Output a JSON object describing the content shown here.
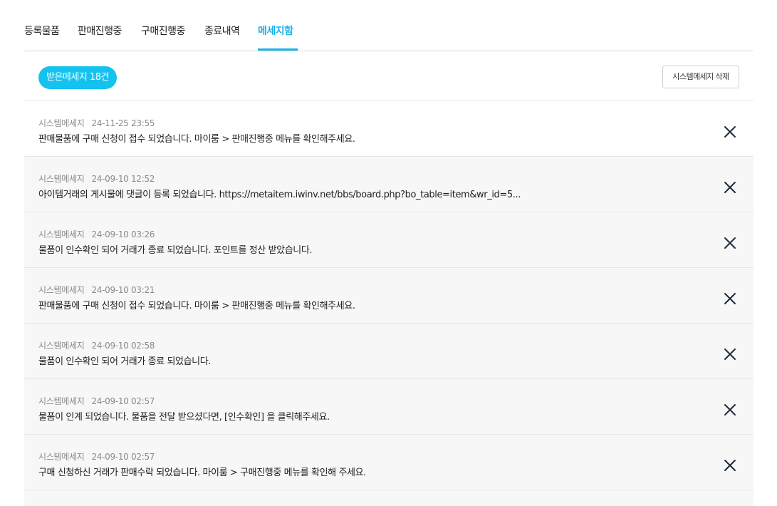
{
  "tabs": [
    {
      "label": "등록물품"
    },
    {
      "label": "판매진행중"
    },
    {
      "label": "구매진행중"
    },
    {
      "label": "종료내역"
    },
    {
      "label": "메세지함"
    }
  ],
  "active_tab": "메세지함",
  "toolbar": {
    "count_label": "받은메세지 18건",
    "delete_label": "시스템메세지 삭제"
  },
  "messages": [
    {
      "sender": "시스템메세지",
      "time": "24-11-25 23:55",
      "text": "판매물품에 구매 신청이 접수 되었습니다. 마이룸 > 판매진행중 메뉴를 확인해주세요."
    },
    {
      "sender": "시스템메세지",
      "time": "24-09-10 12:52",
      "text": "아이템거래의 게시물에 댓글이 등록 되었습니다. https://metaitem.iwinv.net/bbs/board.php?bo_table=item&wr_id=5..."
    },
    {
      "sender": "시스템메세지",
      "time": "24-09-10 03:26",
      "text": "물품이 인수확인 되어 거래가 종료 되었습니다. 포인트를 정산 받았습니다."
    },
    {
      "sender": "시스템메세지",
      "time": "24-09-10 03:21",
      "text": "판매물품에 구매 신청이 접수 되었습니다. 마이룸 > 판매진행중 메뉴를 확인해주세요."
    },
    {
      "sender": "시스템메세지",
      "time": "24-09-10 02:58",
      "text": "물품이 인수확인 되어 거래가 종료 되었습니다."
    },
    {
      "sender": "시스템메세지",
      "time": "24-09-10 02:57",
      "text": "물품이 인계 되었습니다. 물품을 전달 받으셨다면, [인수확인] 을 클릭해주세요."
    },
    {
      "sender": "시스템메세지",
      "time": "24-09-10 02:57",
      "text": "구매 신청하신 거래가 판매수락 되었습니다. 마이룸 > 구매진행중 메뉴를 확인해 주세요."
    }
  ],
  "colors": {
    "accent": "#1ab3e8",
    "badge": "#14c2f0"
  },
  "icons": {
    "close": "close-icon"
  }
}
